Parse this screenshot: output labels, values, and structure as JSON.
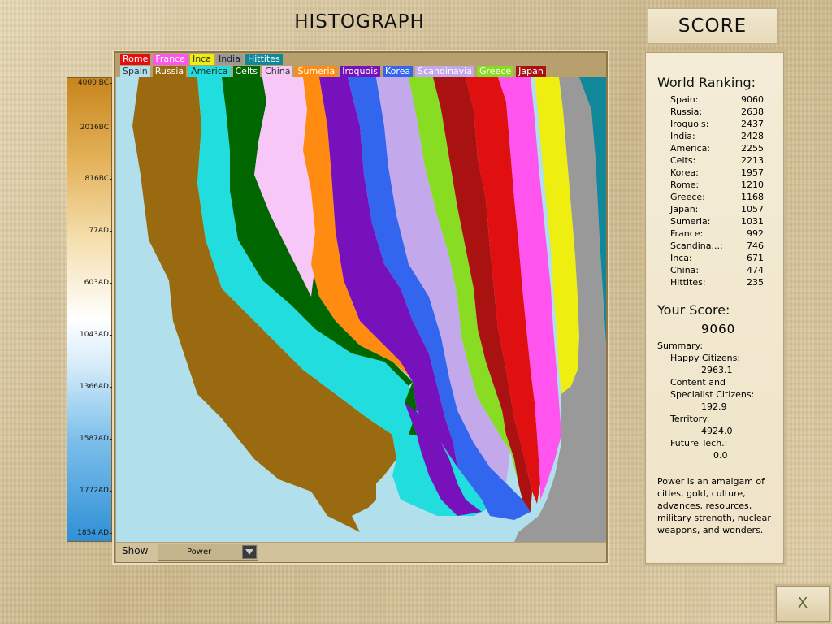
{
  "header": {
    "title": "HISTOGRAPH",
    "score_tab": "SCORE"
  },
  "legend_row1": [
    {
      "name": "Rome",
      "bg": "#e01010",
      "fg": "#ffffff"
    },
    {
      "name": "France",
      "bg": "#ff55ee",
      "fg": "#ffffff"
    },
    {
      "name": "Inca",
      "bg": "#eeee10",
      "fg": "#333333"
    },
    {
      "name": "India",
      "bg": "#999999",
      "fg": "#222222"
    },
    {
      "name": "Hittites",
      "bg": "#118899",
      "fg": "#ffffff"
    }
  ],
  "legend_row2": [
    {
      "name": "Spain",
      "bg": "#b2dfec",
      "fg": "#333333"
    },
    {
      "name": "Russia",
      "bg": "#9a6a10",
      "fg": "#ffffff"
    },
    {
      "name": "America",
      "bg": "#22dddd",
      "fg": "#222222"
    },
    {
      "name": "Celts",
      "bg": "#006600",
      "fg": "#ffffff"
    },
    {
      "name": "China",
      "bg": "#f7c8f7",
      "fg": "#333333"
    },
    {
      "name": "Sumeria",
      "bg": "#ff8c10",
      "fg": "#ffffff"
    },
    {
      "name": "Iroquois",
      "bg": "#7711bb",
      "fg": "#ffffff"
    },
    {
      "name": "Korea",
      "bg": "#3366ee",
      "fg": "#ffffff"
    },
    {
      "name": "Scandinavia",
      "bg": "#c4a8ec",
      "fg": "#ffffff"
    },
    {
      "name": "Greece",
      "bg": "#88dd22",
      "fg": "#ffffff"
    },
    {
      "name": "Japan",
      "bg": "#aa1111",
      "fg": "#ffffff"
    }
  ],
  "timeline_ticks": [
    "4000 BC",
    "2016BC",
    "816BC",
    "77AD",
    "603AD",
    "1043AD",
    "1366AD",
    "1587AD",
    "1772AD",
    "1854 AD"
  ],
  "controls": {
    "show_label": "Show",
    "show_value": "Power"
  },
  "score_panel": {
    "world_ranking_title": "World Ranking:",
    "rankings": [
      {
        "name": "Spain",
        "score": "9060"
      },
      {
        "name": "Russia",
        "score": "2638"
      },
      {
        "name": "Iroquois",
        "score": "2437"
      },
      {
        "name": "India",
        "score": "2428"
      },
      {
        "name": "America",
        "score": "2255"
      },
      {
        "name": "Celts",
        "score": "2213"
      },
      {
        "name": "Korea",
        "score": "1957"
      },
      {
        "name": "Rome",
        "score": "1210"
      },
      {
        "name": "Greece",
        "score": "1168"
      },
      {
        "name": "Japan",
        "score": "1057"
      },
      {
        "name": "Sumeria",
        "score": "1031"
      },
      {
        "name": "France",
        "score": "992"
      },
      {
        "name": "Scandina...:",
        "score": "746"
      },
      {
        "name": "Inca",
        "score": "671"
      },
      {
        "name": "China",
        "score": "474"
      },
      {
        "name": "Hittites",
        "score": "235"
      }
    ],
    "your_score_title": "Your Score:",
    "your_score": "9060",
    "summary_label": "Summary:",
    "happy_label": "Happy Citizens:",
    "happy_value": "2963.1",
    "content_label_1": "Content and",
    "content_label_2": "Specialist Citizens:",
    "content_value": "192.9",
    "territory_label": "Territory:",
    "territory_value": "4924.0",
    "future_label": "Future Tech.:",
    "future_value": "0.0",
    "power_note": "Power is an amalgam of cities, gold, culture, advances, resources, military strength, nuclear weapons, and wonders."
  },
  "exit_button": {
    "label": "X"
  }
}
